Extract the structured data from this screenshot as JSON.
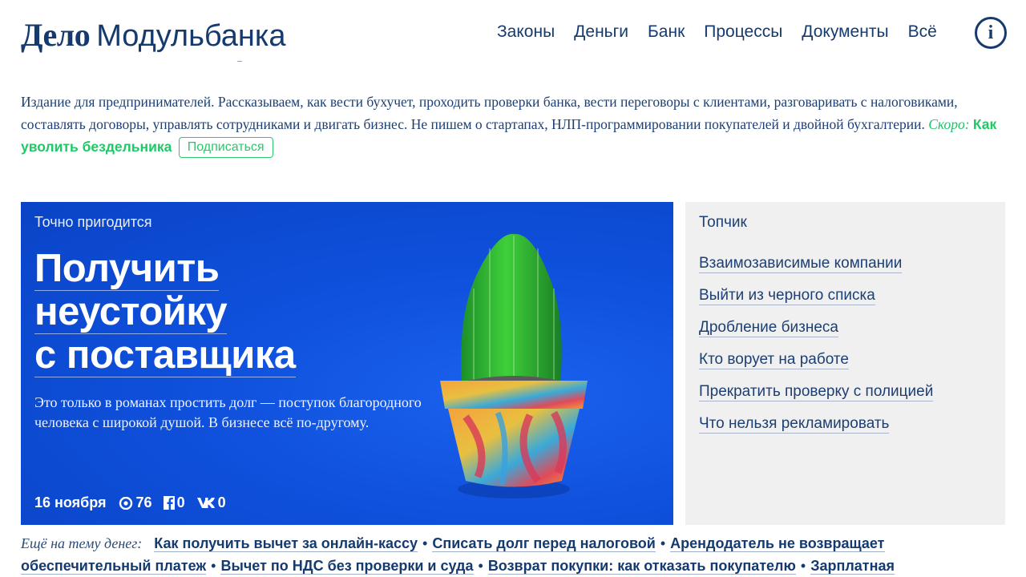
{
  "header": {
    "logo_bold": "Дело",
    "logo_light": "Модульбанка",
    "nav": [
      "Законы",
      "Деньги",
      "Банк",
      "Процессы",
      "Документы",
      "Всё"
    ],
    "info_glyph": "i"
  },
  "intro": {
    "text": "Издание для предпринимателей. Рассказываем, как вести бухучет, проходить проверки банка, вести переговоры с клиентами, разговаривать с налоговиками, составлять договоры, управлять сотрудниками и двигать бизнес. Не пишем о стартапах, НЛП-программировании покупателей и двойной бухгалтерии.",
    "soon_label": "Скоро:",
    "upcoming_title": "Как уволить бездельника",
    "subscribe_label": "Подписаться"
  },
  "hero": {
    "kicker": "Точно пригодится",
    "title_lines": [
      "Получить",
      "неустойку",
      "с поставщика"
    ],
    "lead": "Это только в романах простить долг — поступок благородного человека с широкой душой. В бизнесе всё по-другому.",
    "date": "16 ноября",
    "views": "76",
    "fb_count": "0",
    "vk_count": "0",
    "colors": {
      "background": "#0f50dc"
    }
  },
  "sidebar": {
    "title": "Топчик",
    "links": [
      "Взаимозависимые компании",
      "Выйти из черного списка",
      "Дробление бизнеса",
      "Кто ворует на работе",
      "Прекратить проверку с полицией",
      "Что нельзя рекламировать"
    ]
  },
  "more": {
    "label": "Ещё на тему денег:",
    "links": [
      "Как получить вычет за онлайн-кассу",
      "Списать долг перед налоговой",
      "Арендодатель не возвращает обеспечительный платеж",
      "Вычет по НДС без проверки и суда",
      "Возврат покупки: как отказать покупателю",
      "Зарплатная"
    ]
  },
  "colors": {
    "brand": "#153a6e",
    "accent": "#1ec966",
    "sidebar_bg": "#f0f0f0"
  }
}
